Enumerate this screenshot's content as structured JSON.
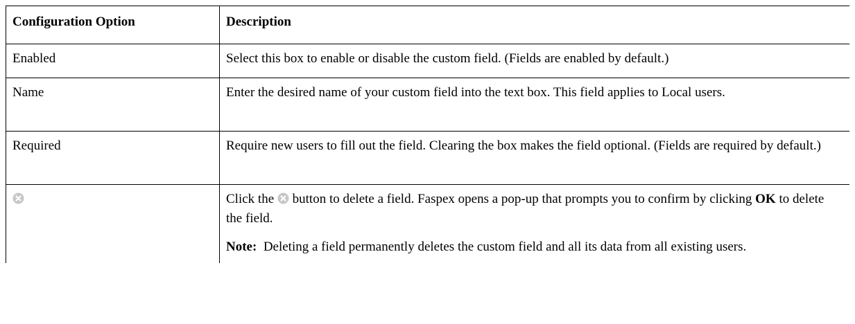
{
  "table": {
    "headers": {
      "option": "Configuration Option",
      "description": "Description"
    },
    "rows": [
      {
        "option": "Enabled",
        "description": "Select this box to enable or disable the custom field. (Fields are enabled by default.)"
      },
      {
        "option": "Name",
        "description": "Enter the desired name of your custom field into the text box. This field applies to Local users."
      },
      {
        "option": "Required",
        "description": "Require new users to fill out the field. Clearing the box makes the field optional. (Fields are required by default.)"
      }
    ],
    "delete_row": {
      "icon": "delete-circle-x-icon",
      "desc_before_icon": "Click the",
      "desc_after_icon": " button to delete a field. Faspex opens a pop-up that prompts you to confirm by clicking ",
      "ok_label": "OK",
      "desc_end": " to delete the field.",
      "note_label": "Note:",
      "note_text": "  Deleting a field permanently deletes the custom field and all its data from all existing users."
    }
  },
  "colors": {
    "border": "#000000",
    "icon_fill": "#c7c7c7",
    "icon_x": "#ffffff"
  }
}
